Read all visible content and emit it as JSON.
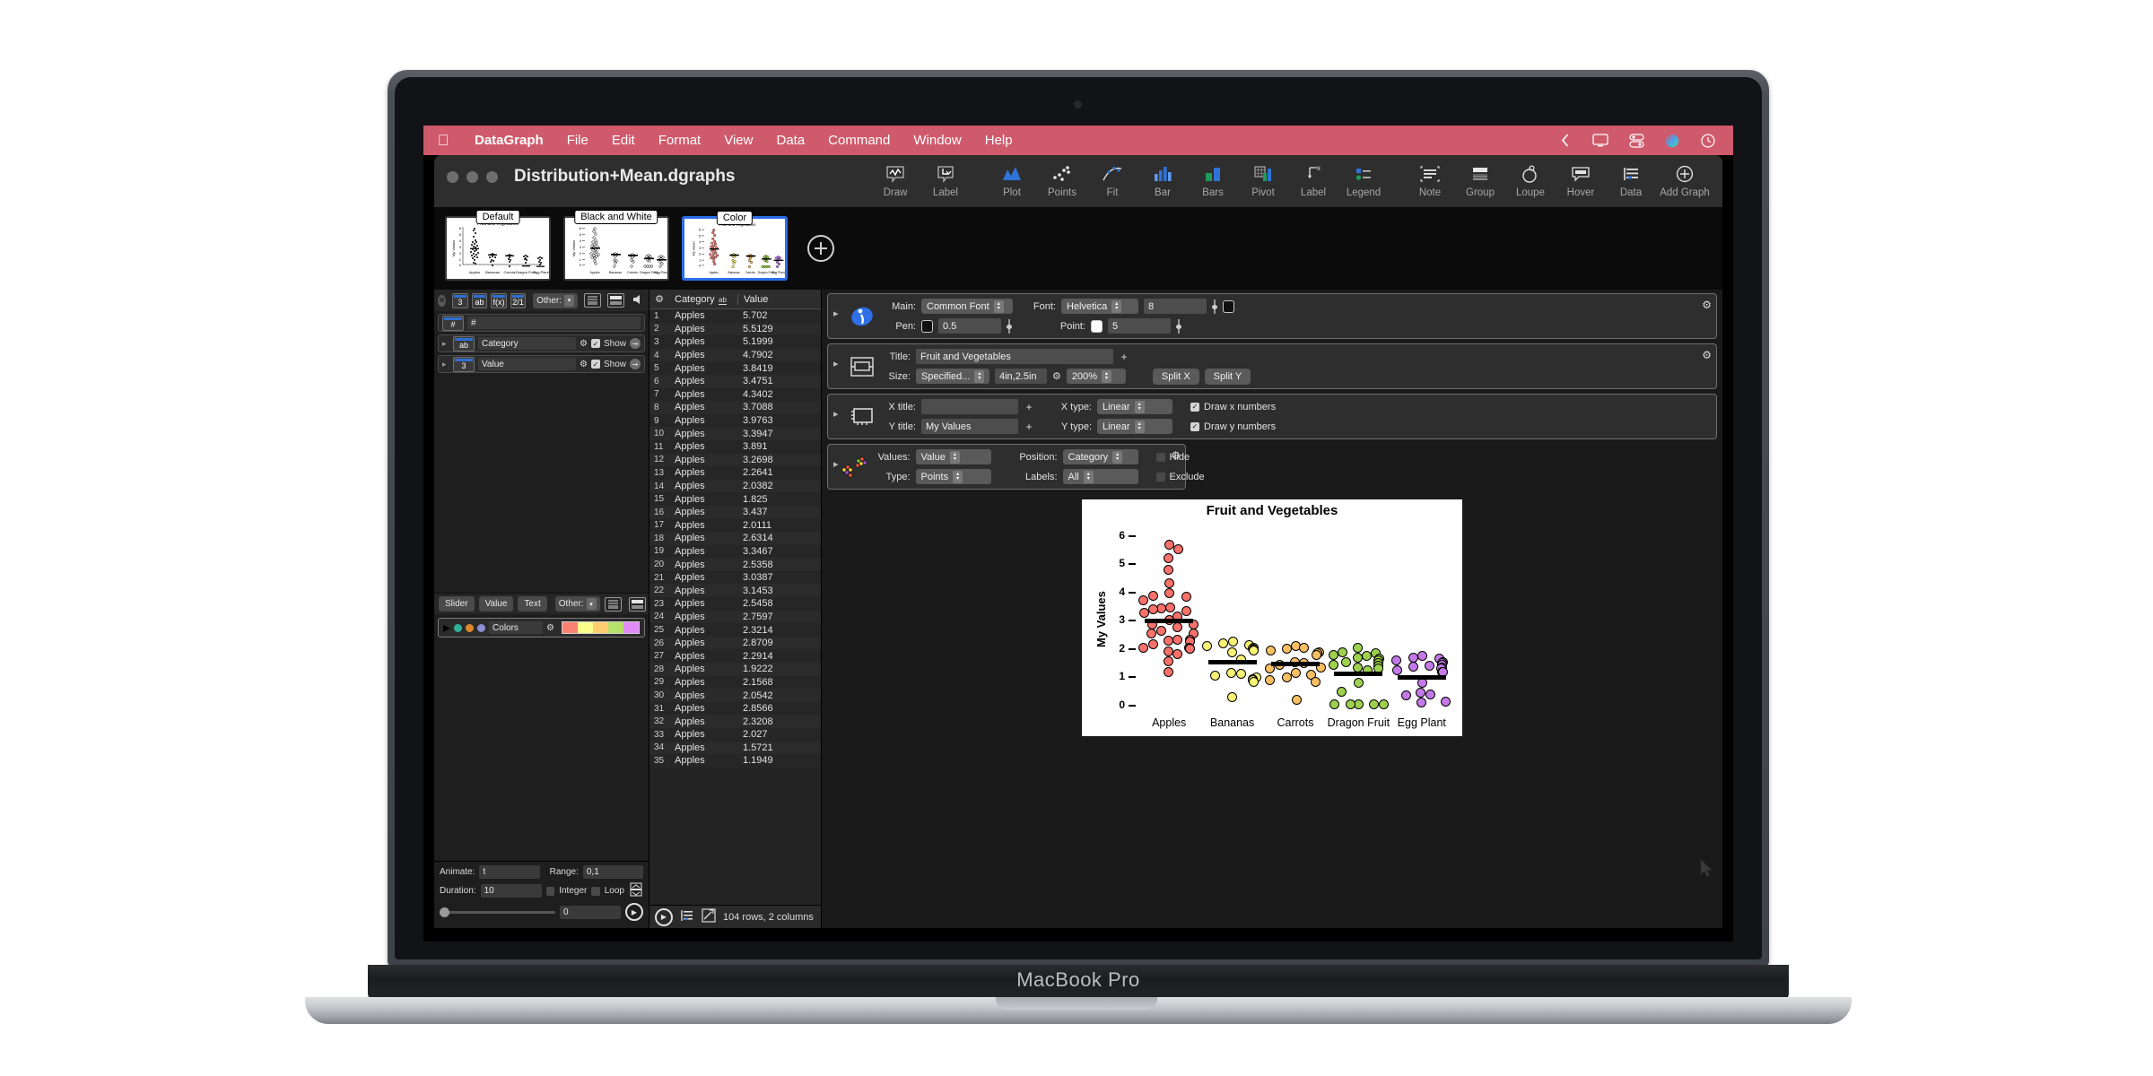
{
  "menubar": {
    "apple": "apple-logo",
    "items": [
      {
        "label": "DataGraph",
        "bold": true
      },
      {
        "label": "File"
      },
      {
        "label": "Edit"
      },
      {
        "label": "Format"
      },
      {
        "label": "View"
      },
      {
        "label": "Data"
      },
      {
        "label": "Command"
      },
      {
        "label": "Window"
      },
      {
        "label": "Help"
      }
    ],
    "right_icons": [
      "back-chevron-icon",
      "display-icon",
      "control-center-icon",
      "siri-icon",
      "clock-icon"
    ],
    "bg": "#cf5a6b"
  },
  "window": {
    "title": "Distribution+Mean.dgraphs",
    "toolbar_left": [
      {
        "label": "Draw",
        "icon": "draw-icon"
      },
      {
        "label": "Label",
        "icon": "label-callout-icon"
      }
    ],
    "toolbar_mid": [
      {
        "label": "Plot",
        "icon": "plot-icon"
      },
      {
        "label": "Points",
        "icon": "points-icon"
      },
      {
        "label": "Fit",
        "icon": "fit-icon"
      },
      {
        "label": "Bar",
        "icon": "bar-icon"
      },
      {
        "label": "Bars",
        "icon": "bars-icon"
      },
      {
        "label": "Pivot",
        "icon": "pivot-icon"
      },
      {
        "label": "Label",
        "icon": "label-x-icon"
      },
      {
        "label": "Legend",
        "icon": "legend-icon"
      }
    ],
    "toolbar_right": [
      {
        "label": "Note",
        "icon": "note-icon"
      },
      {
        "label": "Group",
        "icon": "group-icon"
      },
      {
        "label": "Loupe",
        "icon": "loupe-icon"
      },
      {
        "label": "Hover",
        "icon": "hover-icon"
      },
      {
        "label": "Data",
        "icon": "data-icon"
      },
      {
        "label": "Add Graph",
        "icon": "add-graph-icon"
      }
    ]
  },
  "thumbnails": [
    {
      "label": "Default",
      "selected": false
    },
    {
      "label": "Black and White",
      "selected": false
    },
    {
      "label": "Color",
      "selected": true
    }
  ],
  "variables_panel": {
    "type_buttons": [
      "3",
      "ab",
      "f(x)",
      "2/1"
    ],
    "other_label": "Other:",
    "rows": [
      {
        "type": "#",
        "name": "#",
        "show": null
      },
      {
        "type": "ab",
        "name": "Category",
        "show_label": "Show",
        "show": true
      },
      {
        "type": "3",
        "name": "Value",
        "show_label": "Show",
        "show": true
      }
    ],
    "bottom_buttons": [
      "Slider",
      "Value",
      "Text"
    ],
    "bottom_other_label": "Other:",
    "colors_row": {
      "name": "Colors",
      "dots": [
        "#2fb39a",
        "#e0862a",
        "#8b8fd4"
      ],
      "swatches": [
        "#fa8072",
        "#fdfd8a",
        "#ffcc70",
        "#b5e06a",
        "#e08af5"
      ]
    },
    "animate": {
      "animate_label": "Animate:",
      "animate_value": "t",
      "range_label": "Range:",
      "range_value": "0,1",
      "duration_label": "Duration:",
      "duration_value": "10",
      "integer_label": "Integer",
      "integer_checked": false,
      "loop_label": "Loop",
      "loop_checked": false,
      "slider_value": "0"
    }
  },
  "data_table": {
    "columns": [
      "Category",
      "Value"
    ],
    "rows": [
      {
        "n": "1",
        "category": "Apples",
        "value": "5.702"
      },
      {
        "n": "2",
        "category": "Apples",
        "value": "5.5129"
      },
      {
        "n": "3",
        "category": "Apples",
        "value": "5.1999"
      },
      {
        "n": "4",
        "category": "Apples",
        "value": "4.7902"
      },
      {
        "n": "5",
        "category": "Apples",
        "value": "3.8419"
      },
      {
        "n": "6",
        "category": "Apples",
        "value": "3.4751"
      },
      {
        "n": "7",
        "category": "Apples",
        "value": "4.3402"
      },
      {
        "n": "8",
        "category": "Apples",
        "value": "3.7088"
      },
      {
        "n": "9",
        "category": "Apples",
        "value": "3.9763"
      },
      {
        "n": "10",
        "category": "Apples",
        "value": "3.3947"
      },
      {
        "n": "11",
        "category": "Apples",
        "value": "3.891"
      },
      {
        "n": "12",
        "category": "Apples",
        "value": "3.2698"
      },
      {
        "n": "13",
        "category": "Apples",
        "value": "2.2641"
      },
      {
        "n": "14",
        "category": "Apples",
        "value": "2.0382"
      },
      {
        "n": "15",
        "category": "Apples",
        "value": "1.825"
      },
      {
        "n": "16",
        "category": "Apples",
        "value": "3.437"
      },
      {
        "n": "17",
        "category": "Apples",
        "value": "2.0111"
      },
      {
        "n": "18",
        "category": "Apples",
        "value": "2.6314"
      },
      {
        "n": "19",
        "category": "Apples",
        "value": "3.3467"
      },
      {
        "n": "20",
        "category": "Apples",
        "value": "2.5358"
      },
      {
        "n": "21",
        "category": "Apples",
        "value": "3.0387"
      },
      {
        "n": "22",
        "category": "Apples",
        "value": "3.1453"
      },
      {
        "n": "23",
        "category": "Apples",
        "value": "2.5458"
      },
      {
        "n": "24",
        "category": "Apples",
        "value": "2.7597"
      },
      {
        "n": "25",
        "category": "Apples",
        "value": "2.3214"
      },
      {
        "n": "26",
        "category": "Apples",
        "value": "2.8709"
      },
      {
        "n": "27",
        "category": "Apples",
        "value": "2.2914"
      },
      {
        "n": "28",
        "category": "Apples",
        "value": "1.9222"
      },
      {
        "n": "29",
        "category": "Apples",
        "value": "2.1568"
      },
      {
        "n": "30",
        "category": "Apples",
        "value": "2.0542"
      },
      {
        "n": "31",
        "category": "Apples",
        "value": "2.8566"
      },
      {
        "n": "32",
        "category": "Apples",
        "value": "2.3208"
      },
      {
        "n": "33",
        "category": "Apples",
        "value": "2.027"
      },
      {
        "n": "34",
        "category": "Apples",
        "value": "1.5721"
      },
      {
        "n": "35",
        "category": "Apples",
        "value": "1.1949"
      }
    ],
    "status": "104 rows, 2 columns"
  },
  "settings": {
    "style_panel": {
      "icon": "paintbrush-icon",
      "main_label": "Main:",
      "main_value": "Common Font",
      "font_label": "Font:",
      "font_value": "Helvetica",
      "font_size": "8",
      "pen_label": "Pen:",
      "pen_value": "0.5",
      "pen_color": "#101010",
      "point_label": "Point:",
      "point_value": "5",
      "point_color": "#ffffff",
      "text_color": "#101010"
    },
    "graph_panel": {
      "icon": "layout-icon",
      "title_label": "Title:",
      "title_value": "Fruit and Vegetables",
      "size_label": "Size:",
      "size_value": "Specified...",
      "dimensions": "4in,2.5in",
      "zoom_value": "200%",
      "split_x_label": "Split X",
      "split_y_label": "Split Y"
    },
    "axis_panel": {
      "icon": "axis-frame-icon",
      "x_title_label": "X title:",
      "x_title_value": "",
      "y_title_label": "Y title:",
      "y_title_value": "My Values",
      "x_type_label": "X type:",
      "x_type_value": "Linear",
      "y_type_label": "Y type:",
      "y_type_value": "Linear",
      "draw_x_label": "Draw x numbers",
      "draw_x_checked": true,
      "draw_y_label": "Draw y numbers",
      "draw_y_checked": true
    },
    "points_panel": {
      "icon": "scatter-points-icon",
      "values_label": "Values:",
      "values_value": "Value",
      "type_label": "Type:",
      "type_value": "Points",
      "position_label": "Position:",
      "position_value": "Category",
      "labels_label": "Labels:",
      "labels_value": "All",
      "hide_label": "Hide",
      "hide_checked": false,
      "exclude_label": "Exclude",
      "exclude_checked": false
    }
  },
  "chart_data": {
    "type": "scatter",
    "title": "Fruit and Vegetables",
    "xlabel": "",
    "ylabel": "My Values",
    "ylim": [
      0,
      6.4
    ],
    "yticks": [
      0,
      1,
      2,
      3,
      4,
      5,
      6
    ],
    "ytick_labels": [
      "0",
      "1",
      "2",
      "3",
      "4",
      "5",
      "6"
    ],
    "grid": false,
    "legend": "none",
    "categories": [
      "Apples",
      "Bananas",
      "Carrots",
      "Dragon Fruit",
      "Egg Plant"
    ],
    "colors": [
      "#f8716a",
      "#f7f274",
      "#f8bf62",
      "#9ed14f",
      "#c479e8"
    ],
    "means": [
      3.0,
      1.55,
      1.48,
      1.13,
      1.0
    ],
    "series": [
      {
        "name": "Apples",
        "color": "#f8716a",
        "values": [
          5.702,
          5.5129,
          5.1999,
          4.7902,
          4.3402,
          3.9763,
          3.891,
          3.8419,
          3.7088,
          3.4751,
          3.437,
          3.3947,
          3.3467,
          3.2698,
          3.1453,
          3.0387,
          2.8709,
          2.8566,
          2.7597,
          2.6314,
          2.5458,
          2.5358,
          2.3214,
          2.3208,
          2.2914,
          2.2641,
          2.1568,
          2.0542,
          2.038,
          2.027,
          2.0111,
          1.9222,
          1.825,
          1.5721,
          1.1949
        ]
      },
      {
        "name": "Bananas",
        "color": "#f7f274",
        "values": [
          2.25,
          2.2,
          2.15,
          2.1,
          2.05,
          2.0,
          1.98,
          1.95,
          1.9,
          1.62,
          1.15,
          1.12,
          1.05,
          1.0,
          0.95,
          0.9,
          0.85,
          0.3
        ]
      },
      {
        "name": "Carrots",
        "color": "#f8bf62",
        "values": [
          2.1,
          2.05,
          2.0,
          1.95,
          1.9,
          1.85,
          1.8,
          1.55,
          1.5,
          1.45,
          1.35,
          1.3,
          1.15,
          1.1,
          1.0,
          0.9,
          0.85,
          0.2
        ]
      },
      {
        "name": "Dragon Fruit",
        "color": "#9ed14f",
        "values": [
          2.05,
          1.9,
          1.85,
          1.8,
          1.75,
          1.7,
          1.65,
          1.6,
          1.55,
          1.5,
          1.45,
          1.4,
          1.35,
          1.3,
          1.25,
          0.8,
          0.5,
          0.05,
          0.05,
          0.05,
          0.05,
          0.05
        ]
      },
      {
        "name": "Egg Plant",
        "color": "#c479e8",
        "values": [
          1.75,
          1.7,
          1.65,
          1.6,
          1.55,
          1.5,
          1.45,
          1.4,
          1.38,
          1.35,
          1.3,
          1.25,
          1.2,
          1.18,
          0.8,
          0.45,
          0.4,
          0.35,
          0.15,
          0.12
        ]
      }
    ]
  },
  "device": {
    "model": "MacBook Pro"
  }
}
